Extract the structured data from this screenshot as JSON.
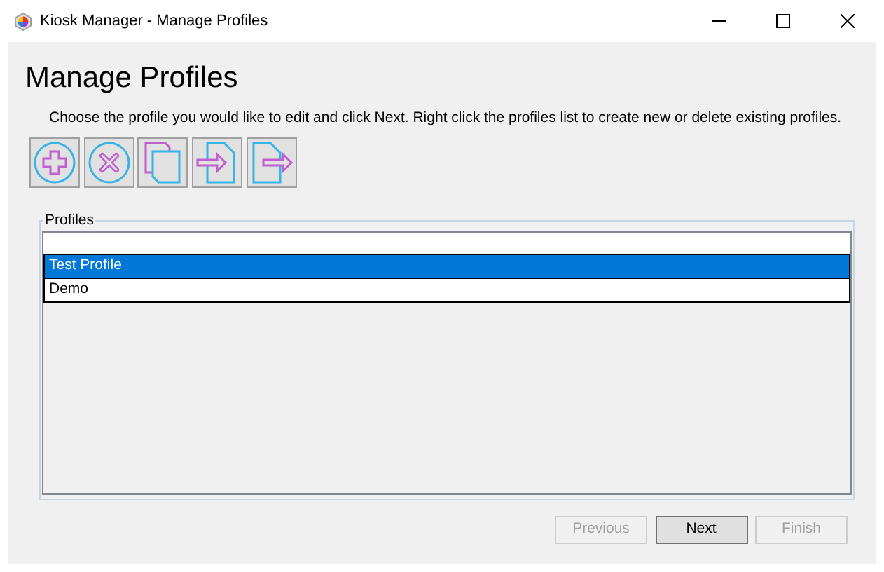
{
  "window": {
    "title": "Kiosk Manager - Manage Profiles"
  },
  "heading": "Manage Profiles",
  "instructions": "Choose the profile you would like to edit and click Next. Right click the profiles list to create new or delete existing profiles.",
  "toolbar": [
    {
      "kind": "add"
    },
    {
      "kind": "delete"
    },
    {
      "kind": "copy"
    },
    {
      "kind": "import"
    },
    {
      "kind": "export"
    }
  ],
  "profiles": {
    "label": "Profiles",
    "rows": [
      {
        "name": "Test Profile",
        "selected": true
      },
      {
        "name": "Demo",
        "selected": false
      }
    ]
  },
  "buttons": [
    {
      "label": "Previous",
      "disabled": true,
      "default": false
    },
    {
      "label": "Next",
      "disabled": false,
      "default": true
    },
    {
      "label": "Finish",
      "disabled": true,
      "default": false
    }
  ]
}
